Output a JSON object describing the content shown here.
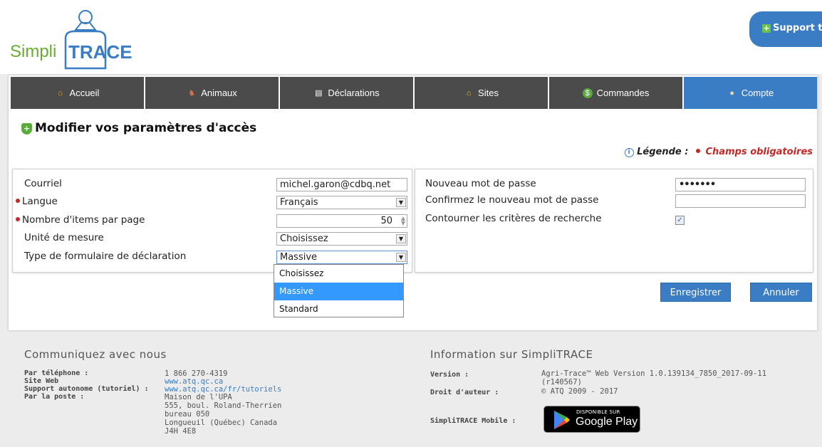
{
  "brand": {
    "logo_text_1": "Simpli",
    "logo_text_2": "TRACE"
  },
  "support": {
    "label": "Support t"
  },
  "nav": [
    {
      "label": "Accueil",
      "icon": "home-icon"
    },
    {
      "label": "Animaux",
      "icon": "animal-icon"
    },
    {
      "label": "Déclarations",
      "icon": "document-icon"
    },
    {
      "label": "Sites",
      "icon": "site-icon"
    },
    {
      "label": "Commandes",
      "icon": "coin-icon"
    },
    {
      "label": "Compte",
      "icon": "user-icon",
      "active": true
    }
  ],
  "page": {
    "title": "Modifier vos paramètres d'accès"
  },
  "legend": {
    "label": "Légende :",
    "required": "Champs obligatoires"
  },
  "form_left": {
    "email_label": "Courriel",
    "email_value": "michel.garon@cdbq.net",
    "language_label": "Langue",
    "language_value": "Français",
    "items_label": "Nombre d'items par page",
    "items_value": "50",
    "unit_label": "Unité de mesure",
    "unit_value": "Choisissez",
    "formtype_label": "Type de formulaire de déclaration",
    "formtype_value": "Massive",
    "formtype_options": [
      "Choisissez",
      "Massive",
      "Standard"
    ]
  },
  "form_right": {
    "newpass_label": "Nouveau mot de passe",
    "newpass_value": "•••••••",
    "confirm_label": "Confirmez le nouveau mot de passe",
    "confirm_value": "",
    "bypass_label": "Contourner les critères de recherche",
    "bypass_checked": true
  },
  "buttons": {
    "save": "Enregistrer",
    "cancel": "Annuler"
  },
  "footer": {
    "contact_title": "Communiquez avec nous",
    "phone_label": "Par téléphone :",
    "phone_value": "1 866 270-4319",
    "web_label": "Site Web",
    "web_value": "www.atq.qc.ca",
    "support_label": "Support autonome (tutoriel) :",
    "support_value": "www.atq.qc.ca/fr/tutoriels",
    "mail_label": "Par la poste :",
    "mail_lines": [
      "Maison de l'UPA",
      "555, boul. Roland-Therrien",
      "bureau 050",
      "Longueuil (Québec) Canada",
      "J4H 4E8"
    ],
    "info_title": "Information sur SimpliTRACE",
    "version_label": "Version :",
    "version_value_1": "Agri-Trace™ Web Version 1.0.139134_7850_2017-09-11",
    "version_value_2": "(r140567)",
    "copyright_label": "Droit d'auteur :",
    "copyright_value": "© ATQ 2009 - 2017",
    "mobile_label": "SimpliTRACE Mobile :",
    "gplay_small": "DISPONIBLE SUR",
    "gplay_big": "Google Play"
  }
}
